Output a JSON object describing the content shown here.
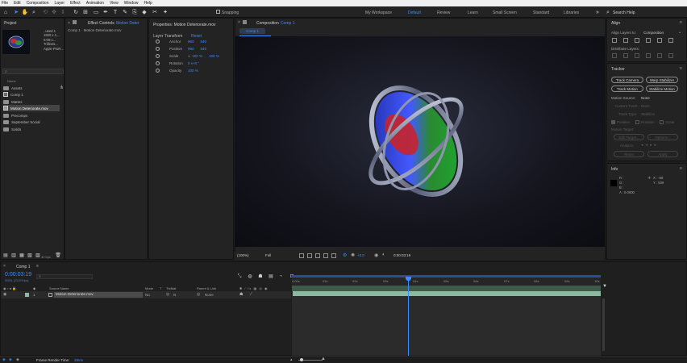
{
  "menu": [
    "File",
    "Edit",
    "Composition",
    "Layer",
    "Effect",
    "Animation",
    "View",
    "Window",
    "Help"
  ],
  "toolbar": {
    "snapping_label": "Snapping",
    "workspaces": [
      "My Workspace",
      "Default",
      "Review",
      "Learn",
      "Small Screen",
      "Standard",
      "Libraries"
    ],
    "active_workspace": "Default",
    "search_placeholder": "Search Help"
  },
  "project": {
    "title": "Project",
    "thumb_info": [
      ", used 1",
      "1920 x 1...",
      "0:00:1...",
      "Trillions...",
      "Apple ProR..."
    ],
    "search_placeholder": "",
    "column_name": "Name",
    "items": [
      {
        "name": "Assets",
        "type": "folder"
      },
      {
        "name": "Comp 1",
        "type": "comp"
      },
      {
        "name": "Mattes",
        "type": "folder"
      },
      {
        "name": "Motion Deteriorate.mov",
        "type": "footage",
        "selected": true
      },
      {
        "name": "Precomps",
        "type": "folder"
      },
      {
        "name": "September Social",
        "type": "folder"
      },
      {
        "name": "Solids",
        "type": "folder"
      }
    ],
    "bpc": "32 bpc"
  },
  "effect_controls": {
    "title": "Effect Controls",
    "layer": "Motion Deter",
    "breadcrumb": "Comp 1 · Motion Deteriorate.mov"
  },
  "properties": {
    "title": "Properties: Motion Deteriorate.mov",
    "section": "Layer Transform",
    "reset": "Reset",
    "rows": [
      {
        "name": "Anchor",
        "v1": "960",
        "v2": "540"
      },
      {
        "name": "Position",
        "v1": "960",
        "v2": "540"
      },
      {
        "name": "Scale",
        "v1": "100 %",
        "v2": "100 %"
      },
      {
        "name": "Rotation",
        "v1": "0 x+0 °",
        "v2": ""
      },
      {
        "name": "Opacity",
        "v1": "100 %",
        "v2": ""
      }
    ]
  },
  "composition": {
    "title": "Composition",
    "comp_name": "Comp 1",
    "tab": "Comp 1",
    "zoom": "(100%)",
    "resolution": "Full",
    "exposure": "+0.0",
    "timecode": "0:00:03:19"
  },
  "align": {
    "title": "Align",
    "align_to_label": "Align Layers to:",
    "align_to_value": "Composition",
    "distribute_label": "Distribute Layers:"
  },
  "tracker": {
    "title": "Tracker",
    "buttons": [
      "Track Camera",
      "Warp Stabilizer",
      "Track Motion",
      "Stabilize Motion"
    ],
    "motion_source_label": "Motion Source:",
    "motion_source_value": "None",
    "current_track_label": "Current Track:",
    "current_track_value": "None",
    "track_type_label": "Track Type:",
    "track_type_value": "Stabilize",
    "checks": [
      "Position",
      "Rotation",
      "Scale"
    ],
    "motion_target": "Motion Target:",
    "edit_target": "Edit Target...",
    "options": "Options...",
    "analyze": "Analyze:",
    "reset": "Reset",
    "apply": "Apply"
  },
  "info": {
    "title": "Info",
    "r": "R :",
    "g": "G :",
    "b": "B :",
    "a": "A : 0.0000",
    "x": "X : -69",
    "y": "Y : 539"
  },
  "timeline": {
    "tab": "Comp 1",
    "timecode": "0:00:03:19",
    "sub_timecode": "00091 (23.976 fps)",
    "columns": [
      "Source Name",
      "Mode",
      "T",
      "TrkMat",
      "Parent & Link"
    ],
    "layer": {
      "index": "1",
      "name": "Motion Deteriorate.mov",
      "mode": "No",
      "trkmat": "N",
      "parent": "None"
    },
    "ruler": [
      "0:00s",
      "01s",
      "02s",
      "03s",
      "04s",
      "05s",
      "06s",
      "07s",
      "08s",
      "09s",
      "10s"
    ],
    "playhead_fraction": 0.376,
    "render_label": "Frame Render Time:",
    "render_value": "38ms"
  },
  "colors": {
    "accent": "#3b8cff",
    "layer_bar": "#8fb8a1",
    "work_area": "#3d5a4a"
  }
}
